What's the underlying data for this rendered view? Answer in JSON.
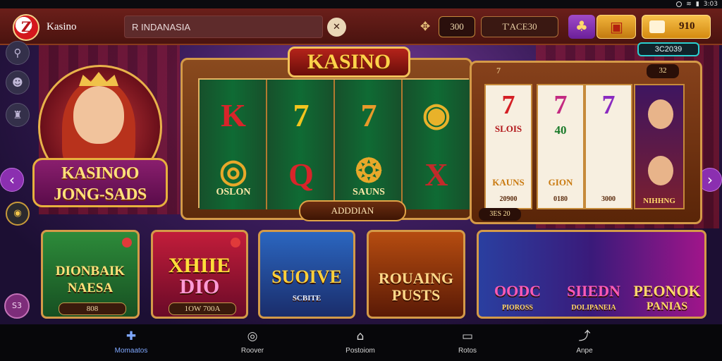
{
  "status_bar": {
    "time": "3:03"
  },
  "header": {
    "app_name": "Kasino",
    "search_value": "R INDANASIA",
    "coin_count": "300",
    "balance_label": "T'ACE30",
    "gold_amount": "910"
  },
  "hero": {
    "title_line1": "KASINOO",
    "title_line2": "JONG-SADS"
  },
  "slot_machine": {
    "title": "KASINO",
    "reels": [
      {
        "top": "K",
        "bottom": "Q",
        "bottom_label": "OSLON"
      },
      {
        "top": "7",
        "bottom": "Q",
        "bottom_label": ""
      },
      {
        "top": "7",
        "bottom": "",
        "bottom_label": "SAUNS"
      },
      {
        "top": "",
        "bottom": "X",
        "bottom_label": ""
      }
    ],
    "spin_label": "ADDDIAN"
  },
  "second_machine": {
    "header": "7",
    "badge": "32",
    "jackpot": "3C2039",
    "footer": "3ES 20",
    "reels": [
      {
        "symbol": "7",
        "label": "SLOIS",
        "sub": "KAUNS",
        "foot": "20900"
      },
      {
        "symbol": "7",
        "label": "40",
        "sub": "GION",
        "foot": "0180"
      },
      {
        "symbol": "7",
        "label": "",
        "sub": "",
        "foot": "3000"
      }
    ],
    "portrait_label": "NIHHNG"
  },
  "tiles": [
    {
      "name_line1": "DIONBAIK",
      "name_line2": "NAESA",
      "foot": "808"
    },
    {
      "name_line1": "XHIIE",
      "name_line2": "DIO",
      "foot": "1OW 700A"
    },
    {
      "name_line1": "SUOIVE",
      "name_line2": "SCBITE",
      "foot": ""
    },
    {
      "name_line1": "ROUAING",
      "name_line2": "PUSTS",
      "foot": ""
    },
    {
      "name_a": "OODC",
      "sub_a": "PIOROSS",
      "name_b": "SIIEDN",
      "sub_b": "DOLIPANEIA",
      "name_c": "PEONOK",
      "sub_c": "PANIAS"
    }
  ],
  "rail": {
    "badge": "S3"
  },
  "nav": [
    {
      "label": "Momaatos",
      "icon": "puzzle-icon"
    },
    {
      "label": "Roover",
      "icon": "clock-icon"
    },
    {
      "label": "Postoiom",
      "icon": "home-icon"
    },
    {
      "label": "Rotos",
      "icon": "ticket-icon"
    },
    {
      "label": "Anpe",
      "icon": "share-icon"
    }
  ]
}
